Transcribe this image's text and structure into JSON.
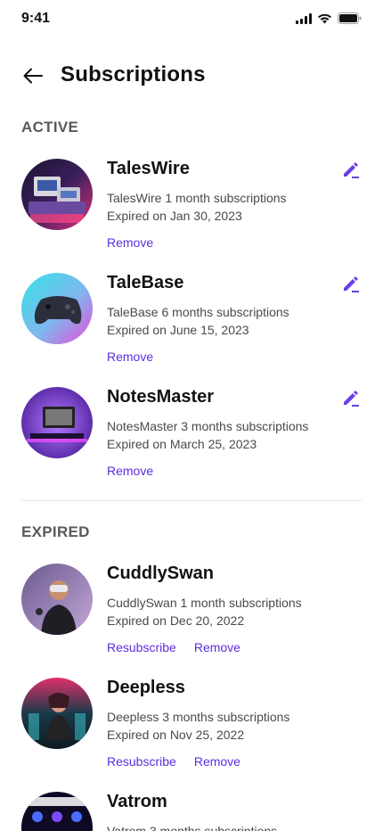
{
  "status": {
    "time": "9:41"
  },
  "header": {
    "title": "Subscriptions"
  },
  "sections": {
    "active": {
      "title": "ACTIVE",
      "items": [
        {
          "name": "TalesWire",
          "desc": "TalesWire 1 month subscriptions",
          "expiry": "Expired on Jan 30, 2023",
          "remove": "Remove"
        },
        {
          "name": "TaleBase",
          "desc": "TaleBase 6 months subscriptions",
          "expiry": "Expired on June 15, 2023",
          "remove": "Remove"
        },
        {
          "name": "NotesMaster",
          "desc": "NotesMaster 3 months subscriptions",
          "expiry": "Expired on March 25, 2023",
          "remove": "Remove"
        }
      ]
    },
    "expired": {
      "title": "EXPIRED",
      "items": [
        {
          "name": "CuddlySwan",
          "desc": "CuddlySwan 1 month subscriptions",
          "expiry": "Expired on Dec 20, 2022",
          "resubscribe": "Resubscribe",
          "remove": "Remove"
        },
        {
          "name": "Deepless",
          "desc": "Deepless 3 months subscriptions",
          "expiry": "Expired on Nov 25, 2022",
          "resubscribe": "Resubscribe",
          "remove": "Remove"
        },
        {
          "name": "Vatrom",
          "desc": "Vatrom 3 months subscriptions"
        }
      ]
    }
  },
  "colors": {
    "accent": "#5b2ee0",
    "edit_icon": "#6b3fe6"
  },
  "icons": {
    "back": "arrow-left-icon",
    "edit": "pencil-icon"
  }
}
